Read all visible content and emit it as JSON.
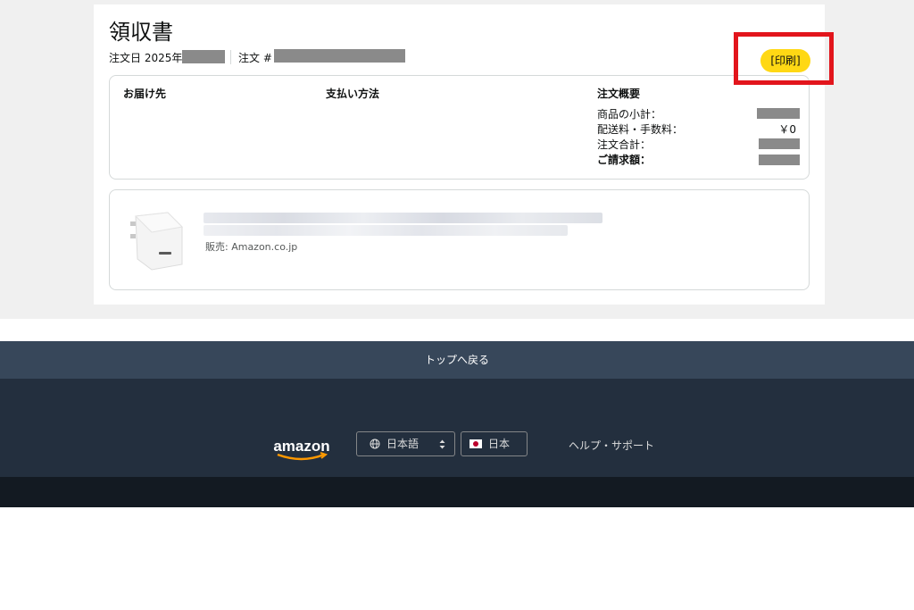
{
  "receipt": {
    "title": "領収書",
    "order_date_label": "注文日 2025年",
    "order_number_label": "注文 #",
    "print_button": "[印刷]"
  },
  "summary": {
    "shipping_heading": "お届け先",
    "payment_heading": "支払い方法",
    "order_summary_heading": "注文概要",
    "rows": [
      {
        "label": "商品の小計：",
        "value": ""
      },
      {
        "label": "配送料・手数料：",
        "value": "￥0"
      },
      {
        "label": "注文合計：",
        "value": ""
      },
      {
        "label": "ご請求額：",
        "value": ""
      }
    ]
  },
  "item": {
    "seller": "販売: Amazon.co.jp",
    "image_icon": "usb-charger-image"
  },
  "footer": {
    "back_to_top": "トップへ戻る",
    "logo_text": "amazon",
    "language": "日本語",
    "country": "日本",
    "help": "ヘルプ・サポート"
  },
  "colors": {
    "print_button": "#ffd814",
    "highlight_border": "#e2151c",
    "back_to_top_bg": "#37475a",
    "footer_bg": "#232f3e",
    "footer_bottom_bg": "#131a22"
  }
}
